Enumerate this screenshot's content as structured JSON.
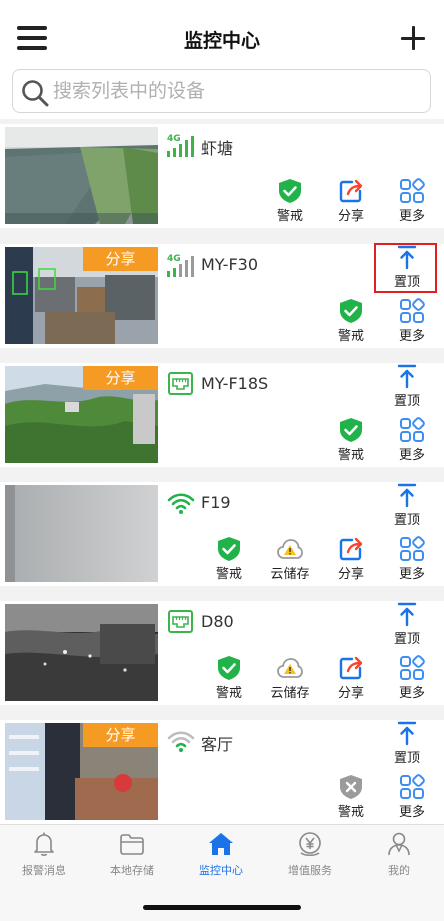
{
  "header": {
    "title": "监控中心",
    "menu_icon": "menu-icon",
    "add_icon": "plus-icon"
  },
  "search": {
    "placeholder": "搜索列表中的设备",
    "value": ""
  },
  "devices": [
    {
      "name": "虾塘",
      "network": "4G",
      "shared": false,
      "share_tag": "",
      "actions": [
        {
          "icon": "shield-check-icon",
          "label": "警戒"
        },
        {
          "icon": "share-icon",
          "label": "分享"
        },
        {
          "icon": "more-icon",
          "label": "更多"
        }
      ]
    },
    {
      "name": "MY-F30",
      "network": "4G",
      "shared": true,
      "share_tag": "分享",
      "top_label": "置顶",
      "actions": [
        {
          "icon": "shield-check-icon",
          "label": "警戒"
        },
        {
          "icon": "more-icon",
          "label": "更多"
        }
      ]
    },
    {
      "name": "MY-F18S",
      "network": "ethernet",
      "shared": true,
      "share_tag": "分享",
      "top_label": "置顶",
      "actions": [
        {
          "icon": "shield-check-icon",
          "label": "警戒"
        },
        {
          "icon": "more-icon",
          "label": "更多"
        }
      ]
    },
    {
      "name": "F19",
      "network": "wifi",
      "shared": false,
      "share_tag": "",
      "top_label": "置顶",
      "actions": [
        {
          "icon": "shield-check-icon",
          "label": "警戒"
        },
        {
          "icon": "cloud-warning-icon",
          "label": "云储存"
        },
        {
          "icon": "share-icon",
          "label": "分享"
        },
        {
          "icon": "more-icon",
          "label": "更多"
        }
      ]
    },
    {
      "name": "D80",
      "network": "ethernet",
      "shared": false,
      "share_tag": "",
      "top_label": "置顶",
      "actions": [
        {
          "icon": "shield-check-icon",
          "label": "警戒"
        },
        {
          "icon": "cloud-warning-icon",
          "label": "云储存"
        },
        {
          "icon": "share-icon",
          "label": "分享"
        },
        {
          "icon": "more-icon",
          "label": "更多"
        }
      ]
    },
    {
      "name": "客厅",
      "network": "wifi-offline",
      "shared": true,
      "share_tag": "分享",
      "top_label": "置顶",
      "actions": [
        {
          "icon": "shield-off-icon",
          "label": "警戒"
        },
        {
          "icon": "more-icon",
          "label": "更多"
        }
      ]
    }
  ],
  "nav": [
    {
      "icon": "bell-icon",
      "label": "报警消息",
      "active": false
    },
    {
      "icon": "folder-icon",
      "label": "本地存储",
      "active": false
    },
    {
      "icon": "home-icon",
      "label": "监控中心",
      "active": true
    },
    {
      "icon": "yen-icon",
      "label": "增值服务",
      "active": false
    },
    {
      "icon": "user-icon",
      "label": "我的",
      "active": false
    }
  ],
  "colors": {
    "accent": "#1a73e8",
    "green": "#21b24a",
    "orange": "#f59a23",
    "highlight": "#e02020",
    "signal": "#3bb54a"
  }
}
